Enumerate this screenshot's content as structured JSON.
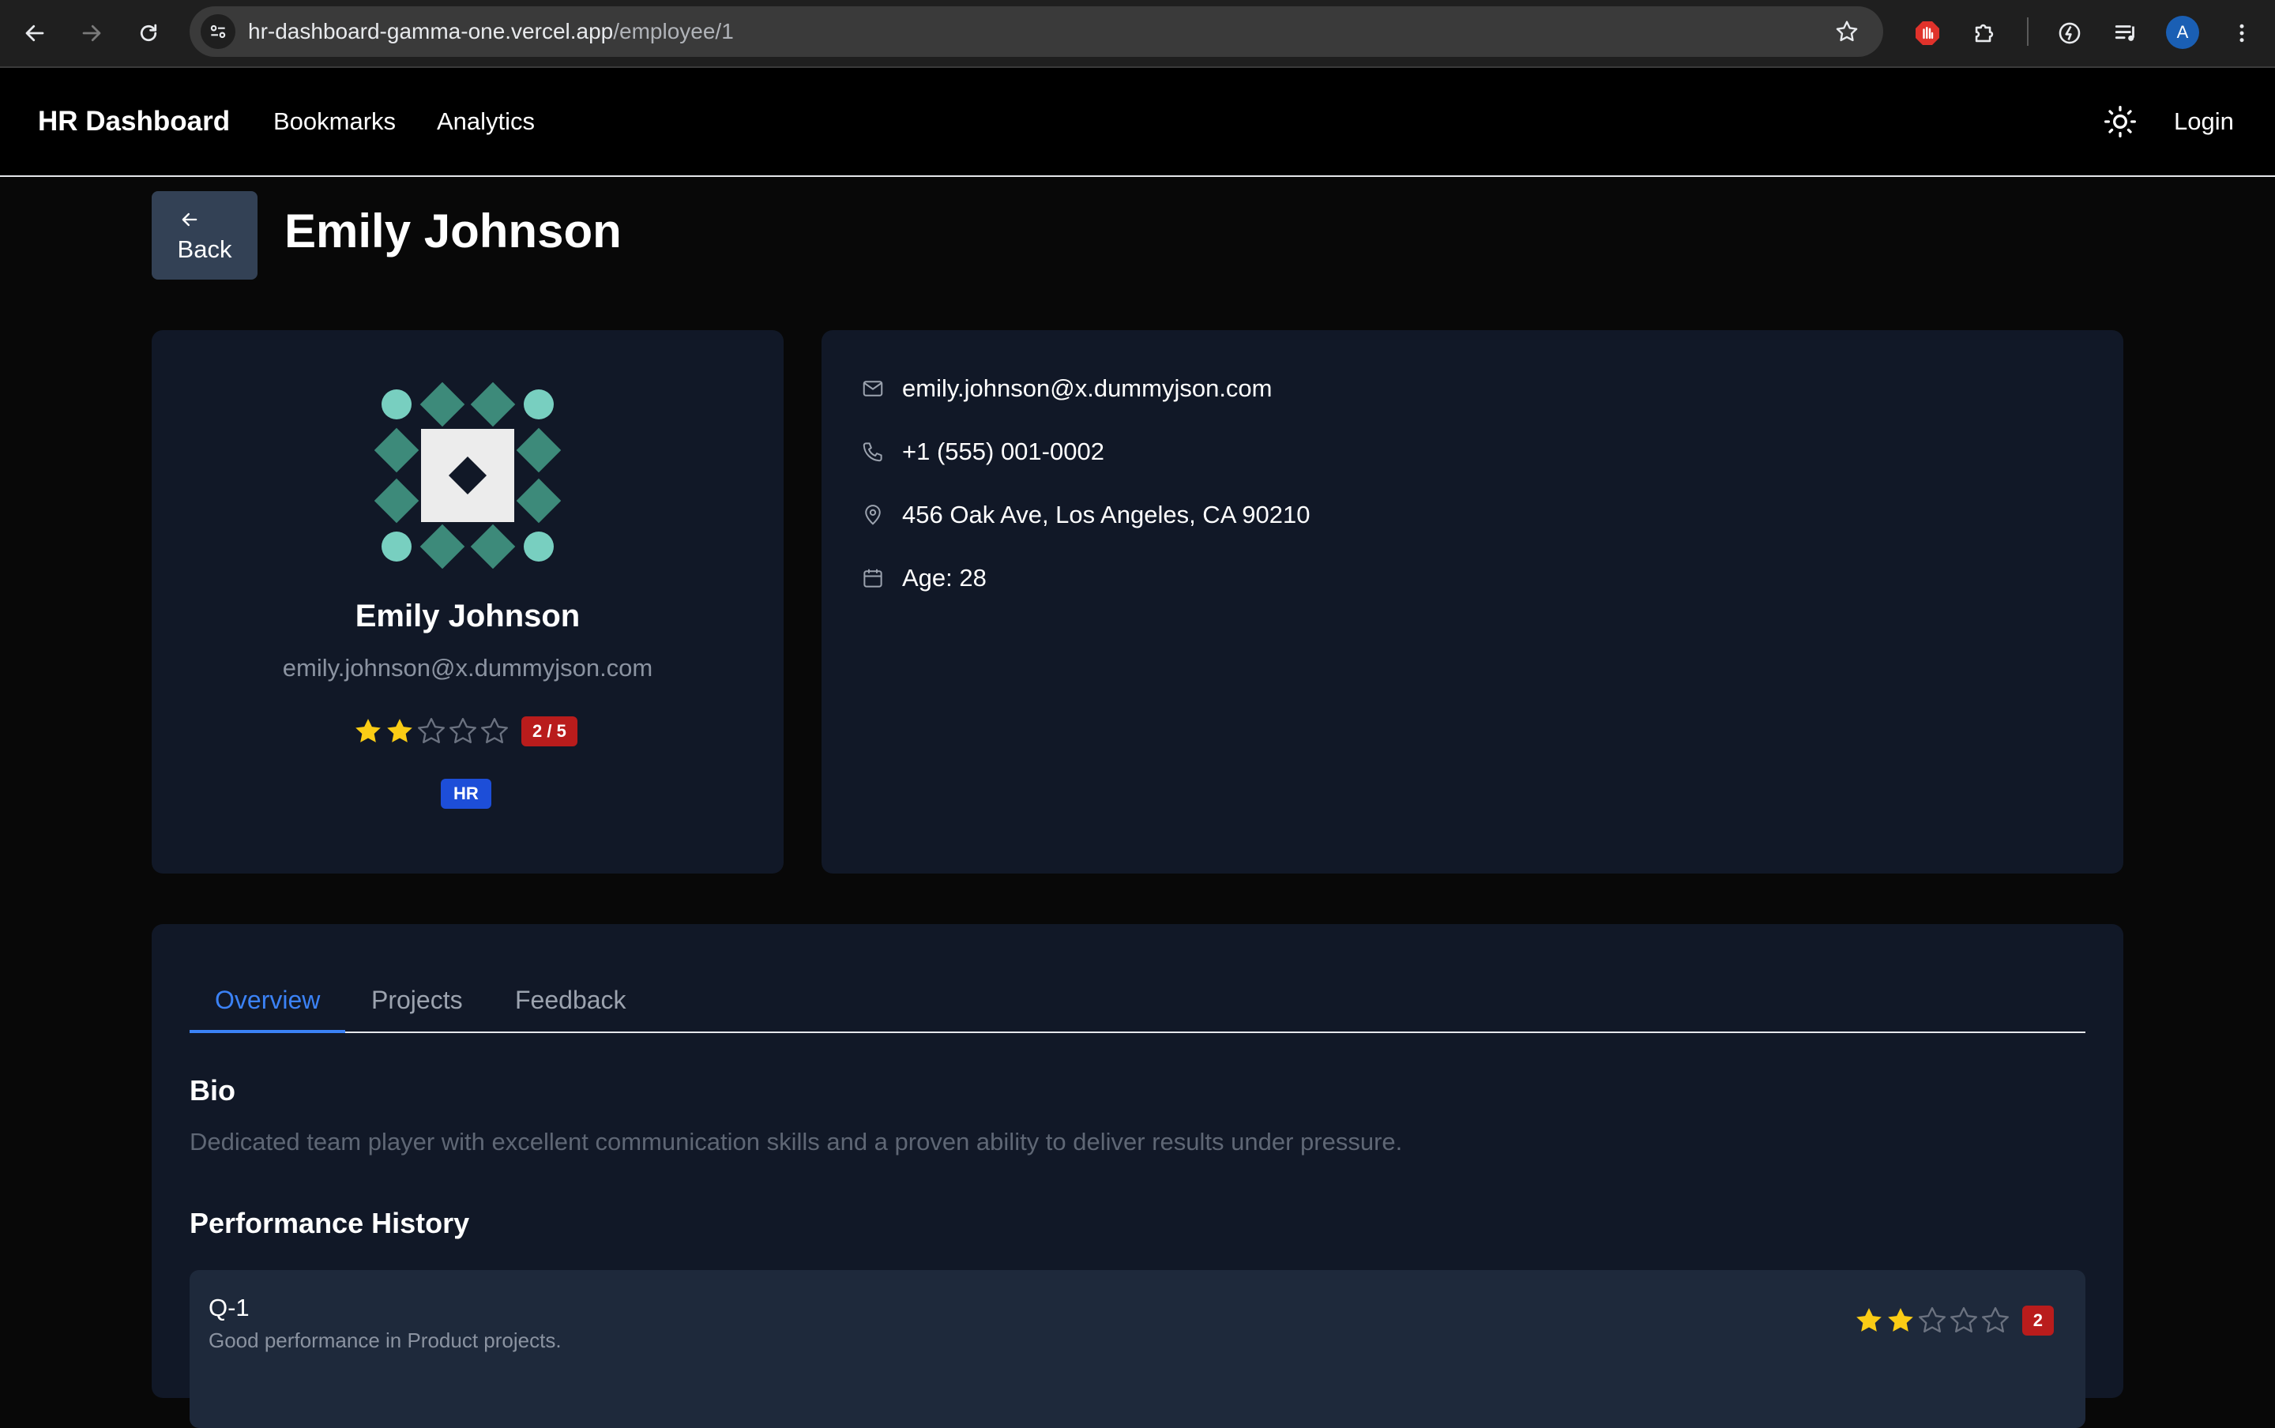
{
  "browser": {
    "url_host": "hr-dashboard-gamma-one.vercel.app",
    "url_path": "/employee/1",
    "profile_initial": "A"
  },
  "nav": {
    "brand": "HR Dashboard",
    "links": [
      "Bookmarks",
      "Analytics"
    ],
    "login": "Login"
  },
  "header": {
    "back_label": "Back",
    "title": "Emily Johnson"
  },
  "profile": {
    "name": "Emily Johnson",
    "email": "emily.johnson@x.dummyjson.com",
    "rating": 2,
    "rating_max": 5,
    "rating_label": "2 / 5",
    "department": "HR"
  },
  "contact": {
    "email": "emily.johnson@x.dummyjson.com",
    "phone": "+1 (555) 001-0002",
    "address": "456 Oak Ave, Los Angeles, CA 90210",
    "age": "Age: 28"
  },
  "tabs": {
    "items": [
      "Overview",
      "Projects",
      "Feedback"
    ],
    "active": "Overview"
  },
  "overview": {
    "bio_heading": "Bio",
    "bio_text": "Dedicated team player with excellent communication skills and a proven ability to deliver results under pressure.",
    "history_heading": "Performance History",
    "history": [
      {
        "quarter": "Q-1",
        "note": "Good performance in Product projects.",
        "rating": 2,
        "rating_label": "2"
      }
    ]
  },
  "colors": {
    "star_filled": "#facc15",
    "star_empty": "#6b7280",
    "rating_badge": "#b91c1c",
    "dept_badge": "#1d4ed8",
    "tab_active": "#3b82f6",
    "avatar_teal": "#3d8a7a",
    "avatar_light": "#78cfc0"
  }
}
